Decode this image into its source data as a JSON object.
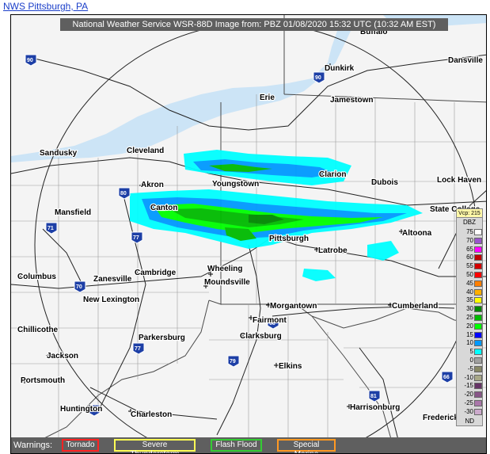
{
  "top_link": "NWS Pittsburgh, PA",
  "header": {
    "title": "National Weather Service WSR-88D Image from: PBZ 01/08/2020 15:32 UTC (10:32 AM EST)"
  },
  "cities": [
    {
      "name": "Buffalo"
    },
    {
      "name": "Dunkirk"
    },
    {
      "name": "Dansville"
    },
    {
      "name": "Erie"
    },
    {
      "name": "Jamestown"
    },
    {
      "name": "Sandusky"
    },
    {
      "name": "Cleveland"
    },
    {
      "name": "Akron"
    },
    {
      "name": "Youngstown"
    },
    {
      "name": "Clarion"
    },
    {
      "name": "Dubois"
    },
    {
      "name": "Lock Haven"
    },
    {
      "name": "Mansfield"
    },
    {
      "name": "Canton"
    },
    {
      "name": "State College"
    },
    {
      "name": "Altoona"
    },
    {
      "name": "Pittsburgh"
    },
    {
      "name": "Latrobe"
    },
    {
      "name": "Columbus"
    },
    {
      "name": "Zanesville"
    },
    {
      "name": "Cambridge"
    },
    {
      "name": "Wheeling"
    },
    {
      "name": "Moundsville"
    },
    {
      "name": "New Lexington"
    },
    {
      "name": "Morgantown"
    },
    {
      "name": "Cumberland"
    },
    {
      "name": "Fairmont"
    },
    {
      "name": "Chillicothe"
    },
    {
      "name": "Parkersburg"
    },
    {
      "name": "Clarksburg"
    },
    {
      "name": "Jackson"
    },
    {
      "name": "Elkins"
    },
    {
      "name": "Portsmouth"
    },
    {
      "name": "Huntington"
    },
    {
      "name": "Charleston"
    },
    {
      "name": "Harrisonburg"
    },
    {
      "name": "Frederick"
    }
  ],
  "road_shields": [
    "90",
    "90",
    "80",
    "71",
    "77",
    "70",
    "77",
    "79",
    "68",
    "81",
    "66",
    "64"
  ],
  "legend": {
    "vcp_label": "Vcp: 215",
    "unit": "DBZ",
    "rows": [
      {
        "value": "75",
        "color": "#ffffff"
      },
      {
        "value": "70",
        "color": "#9955cc"
      },
      {
        "value": "65",
        "color": "#ff00ff"
      },
      {
        "value": "60",
        "color": "#c00000"
      },
      {
        "value": "55",
        "color": "#d40000"
      },
      {
        "value": "50",
        "color": "#ff0000"
      },
      {
        "value": "45",
        "color": "#ff7f00"
      },
      {
        "value": "40",
        "color": "#ffb000"
      },
      {
        "value": "35",
        "color": "#ffff00"
      },
      {
        "value": "30",
        "color": "#008800"
      },
      {
        "value": "25",
        "color": "#00bb00"
      },
      {
        "value": "20",
        "color": "#00ff00"
      },
      {
        "value": "15",
        "color": "#0000ff"
      },
      {
        "value": "10",
        "color": "#0099ff"
      },
      {
        "value": "5",
        "color": "#00ffff"
      },
      {
        "value": "0",
        "color": "#a0a0a0"
      },
      {
        "value": "-5",
        "color": "#888866"
      },
      {
        "value": "-10",
        "color": "#a8a888"
      },
      {
        "value": "-15",
        "color": "#663366"
      },
      {
        "value": "-20",
        "color": "#885588"
      },
      {
        "value": "-25",
        "color": "#aa77aa"
      },
      {
        "value": "-30",
        "color": "#ccaacc"
      }
    ],
    "nd_label": "ND"
  },
  "warnings": {
    "label": "Warnings:",
    "items": [
      {
        "label": "Tornado",
        "color": "#ff2222"
      },
      {
        "label": "Severe Thunderstorm",
        "color": "#ffff55"
      },
      {
        "label": "Flash Flood",
        "color": "#33cc33"
      },
      {
        "label": "Special Marine",
        "color": "#ff9922"
      }
    ]
  },
  "colors": {
    "lake": "#cce4f6",
    "land": "#f4f4f4",
    "header_bg": "#5f5f5f"
  }
}
